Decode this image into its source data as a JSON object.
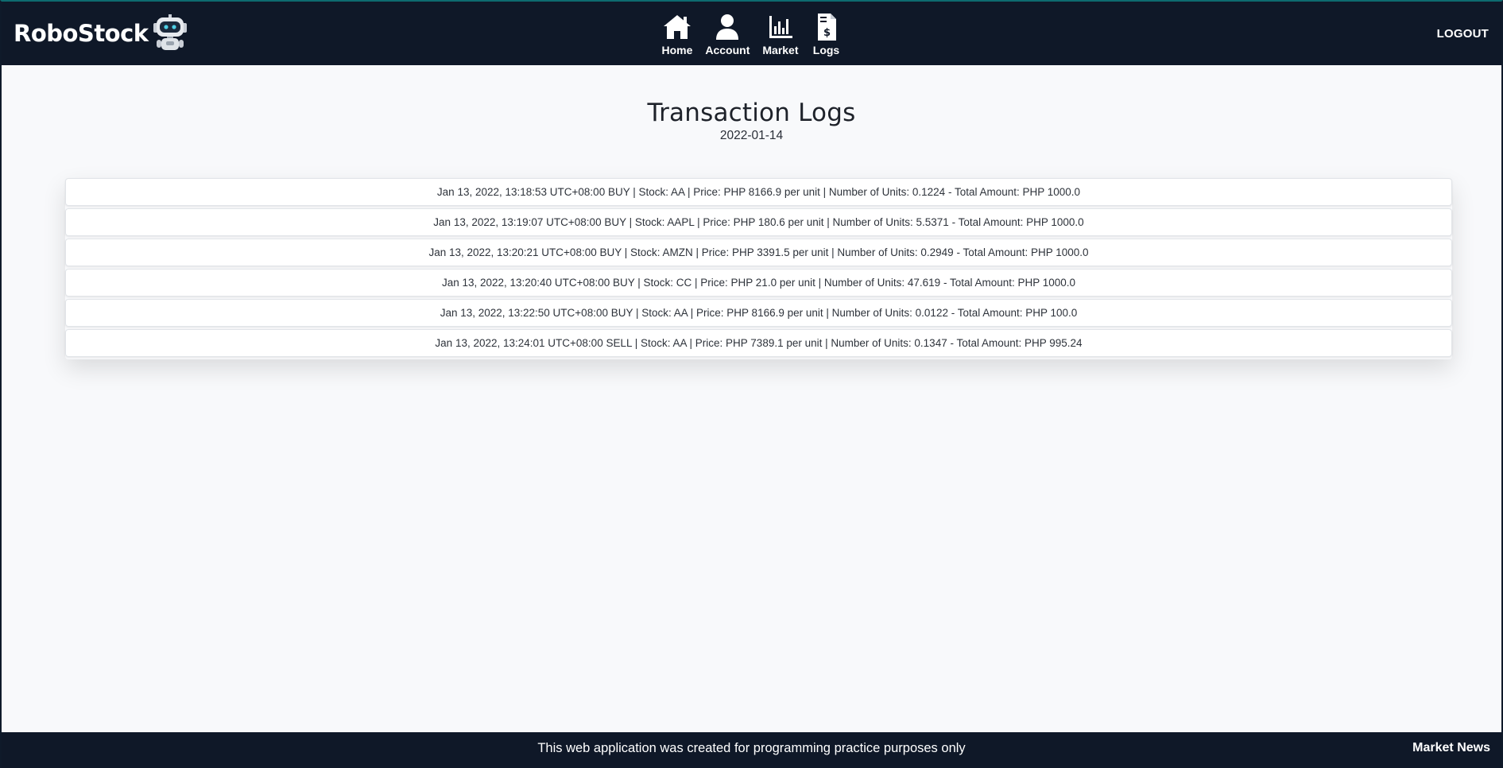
{
  "navbar": {
    "brand": "RoboStock",
    "items": [
      {
        "label": "Home",
        "icon": "home-icon"
      },
      {
        "label": "Account",
        "icon": "user-icon"
      },
      {
        "label": "Market",
        "icon": "bar-chart-icon"
      },
      {
        "label": "Logs",
        "icon": "invoice-icon"
      }
    ],
    "logout": "LOGOUT"
  },
  "main": {
    "title": "Transaction Logs",
    "date": "2022-01-14",
    "logs": [
      "Jan 13, 2022, 13:18:53 UTC+08:00 BUY | Stock: AA | Price: PHP 8166.9 per unit | Number of Units: 0.1224 - Total Amount: PHP 1000.0",
      "Jan 13, 2022, 13:19:07 UTC+08:00 BUY | Stock: AAPL | Price: PHP 180.6 per unit | Number of Units: 5.5371 - Total Amount: PHP 1000.0",
      "Jan 13, 2022, 13:20:21 UTC+08:00 BUY | Stock: AMZN | Price: PHP 3391.5 per unit | Number of Units: 0.2949 - Total Amount: PHP 1000.0",
      "Jan 13, 2022, 13:20:40 UTC+08:00 BUY | Stock: CC | Price: PHP 21.0 per unit | Number of Units: 47.619 - Total Amount: PHP 1000.0",
      "Jan 13, 2022, 13:22:50 UTC+08:00 BUY | Stock: AA | Price: PHP 8166.9 per unit | Number of Units: 0.0122 - Total Amount: PHP 100.0",
      "Jan 13, 2022, 13:24:01 UTC+08:00 SELL | Stock: AA | Price: PHP 7389.1 per unit | Number of Units: 0.1347 - Total Amount: PHP 995.24"
    ]
  },
  "footer": {
    "note": "This web application was created for programming practice purposes only",
    "market_news": "Market News"
  },
  "colors": {
    "navbar_bg": "#0f1828",
    "page_bg": "#f8f9fb",
    "accent_top": "#0d6b6f"
  }
}
